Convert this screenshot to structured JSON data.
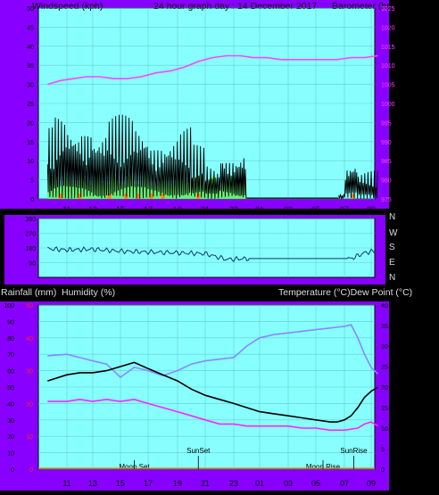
{
  "colors": {
    "outer": "#8800ff",
    "plot_bg": "#88ffff",
    "frame": "#000000",
    "barometer": "#ff44ff",
    "windspeed": "#000000",
    "gust_fill": "#66ee66",
    "rain_bar": "#ff8800",
    "direction": "#0a3c6c",
    "temperature": "#000000",
    "humidity": "#8888ff",
    "dewpoint": "#ff22ff",
    "rain_axis": "#ff2222",
    "sun_line": "#000000"
  },
  "chart_data": [
    {
      "type": "line",
      "panel": "wind-barometer",
      "title": "24 hour graph day : 14 December 2017",
      "ylabel_left": "Windspeed (kph)",
      "ylabel_right": "Barometer (hpa)",
      "x_ticks": [
        "11",
        "13",
        "15",
        "17",
        "19",
        "21",
        "23",
        "01",
        "03",
        "05",
        "07",
        "09"
      ],
      "ylim_left": [
        0,
        50
      ],
      "yticks_left": [
        "0",
        "5",
        "10",
        "15",
        "20",
        "25",
        "30",
        "35",
        "40",
        "45",
        "50"
      ],
      "ylim_right": [
        975,
        1025
      ],
      "yticks_right": [
        "975",
        "980",
        "985",
        "990",
        "995",
        "1000",
        "1005",
        "1010",
        "1015",
        "1020",
        "1025"
      ],
      "series": [
        {
          "key": "barometer",
          "axis": "right",
          "x": [
            9.5,
            10.5,
            11.5,
            12.5,
            13.5,
            14.5,
            15.5,
            16.5,
            17.5,
            18.5,
            19.5,
            20.5,
            21.5,
            22.5,
            23.5,
            24.5,
            25.5,
            26.5,
            27.5,
            28.5,
            29.5,
            30.5,
            31.5,
            32.5,
            33.5
          ],
          "values": [
            1005,
            1006,
            1006.5,
            1007,
            1007,
            1006.5,
            1006.5,
            1007,
            1008,
            1008.5,
            1009.5,
            1011,
            1012,
            1012.5,
            1012.5,
            1012,
            1012,
            1011.5,
            1011.5,
            1011.5,
            1011.5,
            1011.5,
            1012,
            1012,
            1012.5
          ]
        },
        {
          "key": "wind_peak",
          "axis": "left",
          "x": [
            10,
            11,
            12,
            13,
            14,
            15,
            16,
            17,
            18,
            19,
            20,
            21,
            22,
            23,
            24,
            31,
            32,
            33
          ],
          "values": [
            21,
            24,
            22,
            24,
            20,
            24,
            24,
            22,
            20,
            19,
            20,
            15,
            10,
            16,
            15,
            2,
            12,
            8
          ]
        }
      ]
    },
    {
      "type": "line",
      "panel": "wind-direction",
      "right_labels": [
        "N",
        "W",
        "S",
        "E",
        "N"
      ],
      "ylim": [
        0,
        360
      ],
      "yticks": [
        "90",
        "180",
        "270",
        "360"
      ],
      "series": [
        {
          "key": "direction",
          "x": [
            9.5,
            11,
            13,
            15,
            17,
            19,
            21,
            22.5,
            24,
            26,
            28,
            30,
            31.5,
            32.5,
            33.5
          ],
          "values": [
            175,
            168,
            172,
            160,
            155,
            150,
            145,
            110,
            115,
            115,
            115,
            115,
            115,
            150,
            165
          ]
        }
      ]
    },
    {
      "type": "line",
      "panel": "temperature-humidity",
      "ylabel_left": "Rainfall (mm)",
      "ylabel_left2": "Humidity (%)",
      "ylabel_right": "Temperature (°C)Dew Point (°C)",
      "x_ticks": [
        "11",
        "13",
        "15",
        "17",
        "19",
        "21",
        "23",
        "01",
        "03",
        "05",
        "07",
        "09"
      ],
      "ylim_left": [
        0,
        100
      ],
      "yticks_left": [
        "0",
        "10",
        "20",
        "30",
        "40",
        "50",
        "60",
        "70",
        "80",
        "90",
        "100"
      ],
      "ylim_rain": [
        0,
        50
      ],
      "yticks_rain": [
        "0",
        "10",
        "20",
        "30",
        "40",
        "50"
      ],
      "ylim_right": [
        0,
        40
      ],
      "yticks_right": [
        "0",
        "5",
        "10",
        "15",
        "20",
        "25",
        "30",
        "35",
        "40"
      ],
      "annotations": [
        {
          "label": "SunSet",
          "x": 20.5
        },
        {
          "label": "SunRise",
          "x": 31.7
        },
        {
          "label": "Moon Set",
          "x": 16
        },
        {
          "label": "Moon Rise",
          "x": 29.5
        }
      ],
      "series": [
        {
          "key": "temperature",
          "axis": "right",
          "x": [
            9.5,
            11,
            12,
            13,
            14,
            15,
            16,
            17,
            18,
            19,
            20,
            21,
            22,
            23,
            24,
            25,
            26,
            27,
            28,
            29,
            30,
            30.5,
            31,
            31.5,
            32,
            32.5,
            33,
            33.5
          ],
          "values": [
            21.5,
            23,
            23.5,
            23.5,
            24,
            25,
            26,
            24.5,
            23,
            21.5,
            19.5,
            18,
            17,
            16,
            15,
            14,
            13.5,
            13,
            12.5,
            12,
            11.5,
            11.5,
            12,
            13,
            15,
            17.5,
            19,
            20
          ]
        },
        {
          "key": "humidity",
          "axis": "left",
          "x": [
            9.5,
            11,
            13,
            14,
            15,
            16,
            17,
            18,
            19,
            20,
            21,
            22,
            23,
            24,
            25,
            26,
            27,
            28,
            29,
            30,
            31,
            31.5,
            32,
            32.5,
            33,
            33.5
          ],
          "values": [
            69,
            70,
            66,
            64,
            56,
            62,
            60,
            57,
            60,
            64,
            66,
            67,
            68,
            75,
            80,
            82,
            83,
            84,
            85,
            86,
            87,
            88,
            80,
            70,
            62,
            58
          ]
        },
        {
          "key": "dewpoint",
          "axis": "right",
          "x": [
            9.5,
            11,
            12,
            13,
            14,
            15,
            16,
            17,
            18,
            19,
            20,
            21,
            22,
            23,
            24,
            25,
            26,
            27,
            28,
            29,
            30,
            31,
            32,
            32.5,
            33,
            33.5
          ],
          "values": [
            16.5,
            16.5,
            17,
            16.5,
            17,
            16.5,
            17,
            16,
            15,
            14,
            13,
            12,
            11,
            11,
            10.5,
            10.5,
            10.5,
            10.5,
            10,
            10,
            9.5,
            9.5,
            10,
            11,
            11.5,
            10.5
          ]
        }
      ]
    }
  ]
}
